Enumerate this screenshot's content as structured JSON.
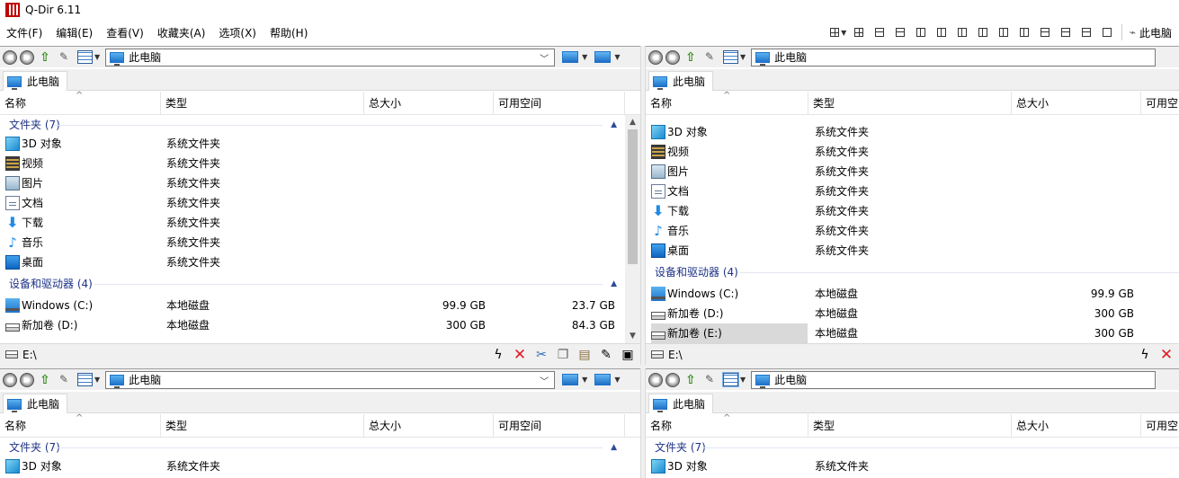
{
  "app": {
    "title": "Q-Dir 6.11"
  },
  "menu": [
    {
      "label": "文件(F)"
    },
    {
      "label": "编辑(E)"
    },
    {
      "label": "查看(V)"
    },
    {
      "label": "收藏夹(A)"
    },
    {
      "label": "选项(X)"
    },
    {
      "label": "帮助(H)"
    }
  ],
  "toolbar": {
    "thispc_label": "此电脑"
  },
  "panes": {
    "top_left": {
      "address": "此电脑",
      "tab": "此电脑",
      "columns": {
        "name": "名称",
        "type": "类型",
        "total": "总大小",
        "free": "可用空间"
      },
      "groups": [
        {
          "label": "文件夹 (7)"
        },
        {
          "label": "设备和驱动器 (4)"
        }
      ],
      "folders": [
        {
          "name": "3D 对象",
          "type": "系统文件夹",
          "icon": "cube-3d-icon"
        },
        {
          "name": "视频",
          "type": "系统文件夹",
          "icon": "video-icon"
        },
        {
          "name": "图片",
          "type": "系统文件夹",
          "icon": "picture-icon"
        },
        {
          "name": "文档",
          "type": "系统文件夹",
          "icon": "document-icon"
        },
        {
          "name": "下载",
          "type": "系统文件夹",
          "icon": "download-icon"
        },
        {
          "name": "音乐",
          "type": "系统文件夹",
          "icon": "music-icon"
        },
        {
          "name": "桌面",
          "type": "系统文件夹",
          "icon": "desktop-icon"
        }
      ],
      "drives": [
        {
          "name": "Windows (C:)",
          "type": "本地磁盘",
          "total": "99.9 GB",
          "free": "23.7 GB"
        },
        {
          "name": "新加卷 (D:)",
          "type": "本地磁盘",
          "total": "300 GB",
          "free": "84.3 GB"
        }
      ],
      "status": "E:\\"
    },
    "top_right": {
      "address": "此电脑",
      "tab": "此电脑",
      "columns": {
        "name": "名称",
        "type": "类型",
        "total": "总大小",
        "free": "可用空"
      },
      "group_drives": "设备和驱动器 (4)",
      "folders": [
        {
          "name": "3D 对象",
          "type": "系统文件夹"
        },
        {
          "name": "视频",
          "type": "系统文件夹"
        },
        {
          "name": "图片",
          "type": "系统文件夹"
        },
        {
          "name": "文档",
          "type": "系统文件夹"
        },
        {
          "name": "下载",
          "type": "系统文件夹"
        },
        {
          "name": "音乐",
          "type": "系统文件夹"
        },
        {
          "name": "桌面",
          "type": "系统文件夹"
        }
      ],
      "drives": [
        {
          "name": "Windows (C:)",
          "type": "本地磁盘",
          "total": "99.9 GB"
        },
        {
          "name": "新加卷 (D:)",
          "type": "本地磁盘",
          "total": "300 GB"
        },
        {
          "name": "新加卷 (E:)",
          "type": "本地磁盘",
          "total": "300 GB"
        }
      ],
      "status": "E:\\"
    },
    "bottom_left": {
      "address": "此电脑",
      "tab": "此电脑",
      "columns": {
        "name": "名称",
        "type": "类型",
        "total": "总大小",
        "free": "可用空间"
      },
      "group_folders": "文件夹 (7)",
      "first_row": {
        "name": "3D 对象",
        "type": "系统文件夹"
      }
    },
    "bottom_right": {
      "address": "此电脑",
      "tab": "此电脑",
      "columns": {
        "name": "名称",
        "type": "类型",
        "total": "总大小",
        "free": "可用空"
      },
      "group_folders": "文件夹 (7)",
      "first_row": {
        "name": "3D 对象",
        "type": "系统文件夹"
      }
    }
  },
  "colors": {
    "group_text": "#1e3287",
    "selection": "#d9d9d9",
    "close_red": "#e01b24"
  }
}
